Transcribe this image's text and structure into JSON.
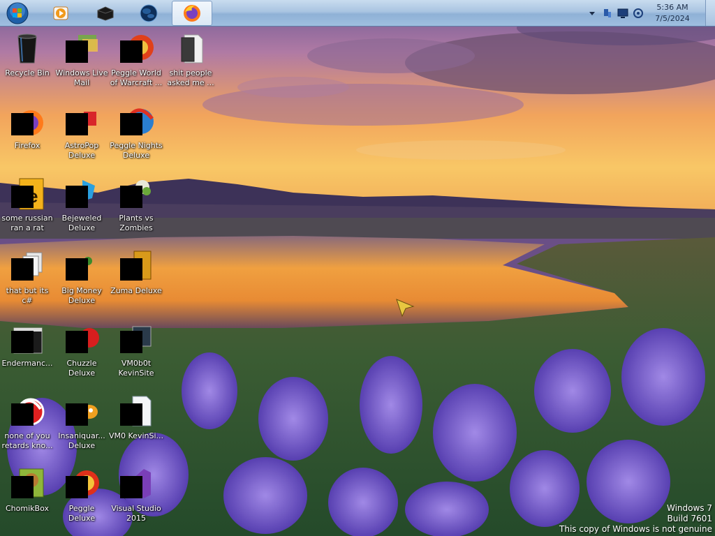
{
  "taskbar": {
    "pinned": [
      {
        "name": "media-player",
        "icon": "media-player-icon",
        "active": false
      },
      {
        "name": "vmware",
        "icon": "black-box-icon",
        "active": false
      },
      {
        "name": "globe",
        "icon": "globe-icon",
        "active": false
      },
      {
        "name": "firefox",
        "icon": "firefox-icon",
        "active": true
      }
    ]
  },
  "tray": {
    "time": "5:36 AM",
    "date": "7/5/2024"
  },
  "desktop": {
    "icons": [
      {
        "label": "Recycle Bin",
        "icon": "recycle-bin-icon"
      },
      {
        "label": "Windows Live Mail",
        "icon": "windows-live-mail-icon"
      },
      {
        "label": "Peggle World of Warcraft ...",
        "icon": "peggle-wow-icon"
      },
      {
        "label": "shit people asked me ...",
        "icon": "folder-icon"
      },
      {
        "label": "Firefox",
        "icon": "firefox-icon"
      },
      {
        "label": "AstroPop Deluxe",
        "icon": "astropop-icon"
      },
      {
        "label": "Peggle Nights Deluxe",
        "icon": "peggle-nights-icon"
      },
      {
        "label": "some russian ran a rat",
        "icon": "illustrator-icon"
      },
      {
        "label": "Bejeweled Deluxe",
        "icon": "bejeweled-icon"
      },
      {
        "label": "Plants vs Zombies",
        "icon": "plants-vs-zombies-icon"
      },
      {
        "label": "that but its c#",
        "icon": "shortcut-stack-icon"
      },
      {
        "label": "Big Money Deluxe",
        "icon": "big-money-icon"
      },
      {
        "label": "Zuma Deluxe",
        "icon": "zuma-icon"
      },
      {
        "label": "Endermanc...",
        "icon": "console-icon"
      },
      {
        "label": "Chuzzle Deluxe",
        "icon": "chuzzle-icon"
      },
      {
        "label": "VM0b0t KevinSite",
        "icon": "vm-icon"
      },
      {
        "label": "none of you retards kno...",
        "icon": "red-app-icon"
      },
      {
        "label": "Insaniquar... Deluxe",
        "icon": "insaniquarium-icon"
      },
      {
        "label": "VM0 KevinSi...",
        "icon": "document-icon"
      },
      {
        "label": "ChomikBox",
        "icon": "chomikbox-icon"
      },
      {
        "label": "Peggle Deluxe",
        "icon": "peggle-icon"
      },
      {
        "label": "Visual Studio 2015",
        "icon": "visual-studio-icon"
      }
    ]
  },
  "watermark": {
    "line1": "Windows 7",
    "line2": "Build 7601",
    "line3": "This copy of Windows is not genuine"
  },
  "colors": {
    "taskbar": "#a9c4e1",
    "sky_top": "#7d5c9a",
    "sunset": "#f6b24a",
    "water": "#e9973b",
    "flowers": "#7a5ad8",
    "grass": "#3c6a34"
  }
}
